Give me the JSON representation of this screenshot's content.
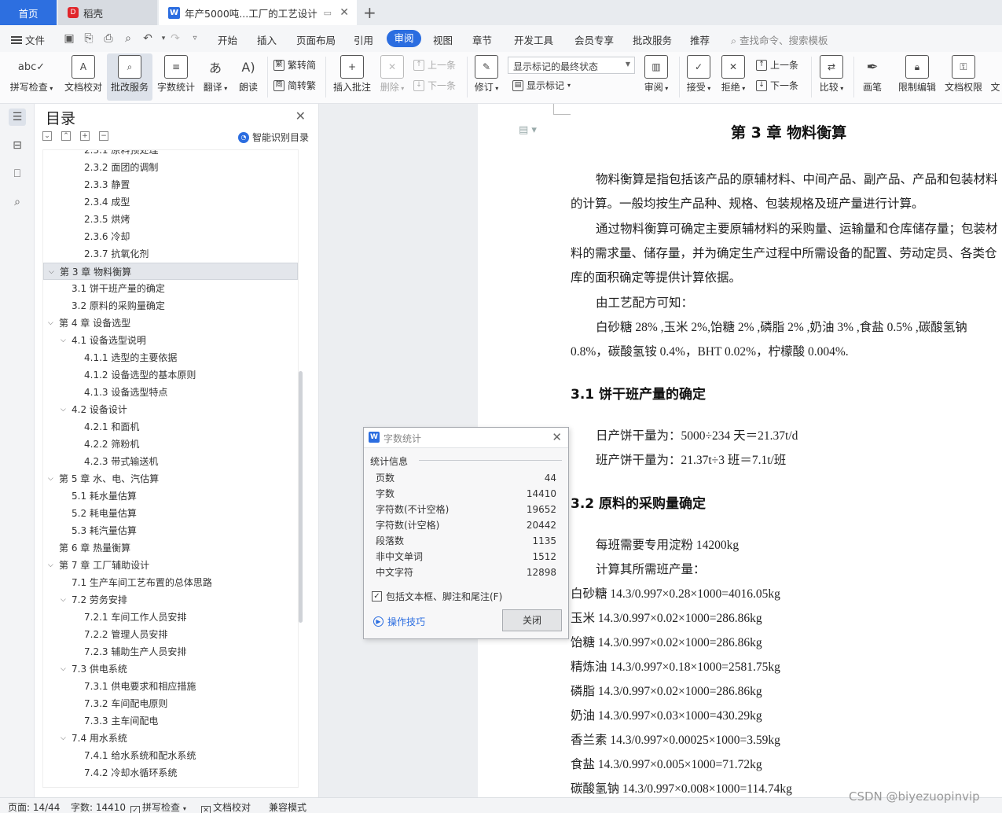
{
  "tabs": {
    "home": "首页",
    "daoke": "稻壳",
    "doc": "年产5000吨...工厂的工艺设计"
  },
  "menu": {
    "file": "文件",
    "items": [
      "开始",
      "插入",
      "页面布局",
      "引用",
      "审阅",
      "视图",
      "章节",
      "开发工具",
      "会员专享",
      "批改服务",
      "推荐"
    ],
    "active": "审阅",
    "search": "查找命令、搜索模板"
  },
  "ribbon": {
    "spell": "拼写检查",
    "doc_check": "文档校对",
    "batch": "批改服务",
    "word_count": "字数统计",
    "translate": "翻译",
    "read": "朗读",
    "trad": "繁转简",
    "simp": "简转繁",
    "insert_comment": "插入批注",
    "delete": "删除",
    "prev": "上一条",
    "next": "下一条",
    "markup_select": "显示标记的最终状态",
    "revise": "修订",
    "show_markup": "显示标记",
    "review": "审阅",
    "accept": "接受",
    "reject": "拒绝",
    "prev2": "上一条",
    "next2": "下一条",
    "compare": "比较",
    "pen": "画笔",
    "restrict": "限制编辑",
    "doc_rights": "文档权限",
    "more": "文"
  },
  "toc": {
    "title": "目录",
    "smart": "智能识别目录",
    "items": [
      {
        "text": "2.3.1  原料预处理",
        "level": 3
      },
      {
        "text": "2.3.2  面团的调制",
        "level": 3
      },
      {
        "text": "2.3.3  静置",
        "level": 3
      },
      {
        "text": "2.3.4  成型",
        "level": 3
      },
      {
        "text": "2.3.5  烘烤",
        "level": 3
      },
      {
        "text": "2.3.6  冷却",
        "level": 3
      },
      {
        "text": "2.3.7  抗氧化剂",
        "level": 3
      },
      {
        "text": "第 3 章  物料衡算",
        "level": 1,
        "expanded": true,
        "selected": true
      },
      {
        "text": "3.1  饼干班产量的确定",
        "level": 2
      },
      {
        "text": "3.2  原料的采购量确定",
        "level": 2
      },
      {
        "text": "第 4 章  设备选型",
        "level": 1,
        "expanded": true
      },
      {
        "text": "4.1  设备选型说明",
        "level": 2,
        "expanded": true
      },
      {
        "text": "4.1.1  选型的主要依据",
        "level": 3
      },
      {
        "text": "4.1.2  设备选型的基本原则",
        "level": 3
      },
      {
        "text": "4.1.3  设备选型特点",
        "level": 3
      },
      {
        "text": "4.2    设备设计",
        "level": 2,
        "expanded": true
      },
      {
        "text": "4.2.1  和面机",
        "level": 3
      },
      {
        "text": "4.2.2  筛粉机",
        "level": 3
      },
      {
        "text": "4.2.3  带式输送机",
        "level": 3
      },
      {
        "text": "第 5 章  水、电、汽估算",
        "level": 1,
        "expanded": true
      },
      {
        "text": "5.1  耗水量估算",
        "level": 2
      },
      {
        "text": "5.2  耗电量估算",
        "level": 2
      },
      {
        "text": "5.3  耗汽量估算",
        "level": 2
      },
      {
        "text": "第 6 章  热量衡算",
        "level": 1
      },
      {
        "text": "第 7 章  工厂辅助设计",
        "level": 1,
        "expanded": true
      },
      {
        "text": "7.1  生产车间工艺布置的总体思路",
        "level": 2
      },
      {
        "text": "7.2  劳务安排",
        "level": 2,
        "expanded": true
      },
      {
        "text": "7.2.1  车间工作人员安排",
        "level": 3
      },
      {
        "text": "7.2.2  管理人员安排",
        "level": 3
      },
      {
        "text": "7.2.3  辅助生产人员安排",
        "level": 3
      },
      {
        "text": "7.3  供电系统",
        "level": 2,
        "expanded": true
      },
      {
        "text": "7.3.1  供电要求和相应措施",
        "level": 3
      },
      {
        "text": "7.3.2  车间配电原则",
        "level": 3
      },
      {
        "text": "7.3.3  主车间配电",
        "level": 3
      },
      {
        "text": "7.4  用水系统",
        "level": 2,
        "expanded": true
      },
      {
        "text": "7.4.1  给水系统和配水系统",
        "level": 3
      },
      {
        "text": "7.4.2  冷却水循环系统",
        "level": 3
      }
    ]
  },
  "document": {
    "chapter_title": "第 3 章  物料衡算",
    "p1a": "物料衡算是指包括该产品的原辅材料、中间产品、副产品、产品和包装材料",
    "p1b": "的计算。一般均按生产品种、规格、包装规格及班产量进行计算。",
    "p2a": "通过物料衡算可确定主要原辅材料的采购量、运输量和仓库储存量；包装材",
    "p2b": "料的需求量、储存量，并为确定生产过程中所需设备的配置、劳动定员、各类仓",
    "p2c": "库的面积确定等提供计算依据。",
    "p3": "由工艺配方可知：",
    "p4a": "白砂糖  28% ,玉米 2%,饴糖 2% ,磷脂 2% ,奶油 3% ,食盐 0.5% ,碳酸氢钠",
    "p4b": "0.8%，碳酸氢铵  0.4%，BHT 0.02%，柠檬酸  0.004%.",
    "h31": "3.1  饼干班产量的确定",
    "daily": "日产饼干量为：5000÷234 天＝21.37t/d",
    "shift": "班产饼干量为：21.37t÷3 班＝7.1t/班",
    "h32": "3.2  原料的采购量确定",
    "starch": "每班需要专用淀粉 14200kg",
    "calc": "计算其所需班产量：",
    "materials": [
      "白砂糖 14.3/0.997×0.28×1000=4016.05kg",
      "玉米 14.3/0.997×0.02×1000=286.86kg",
      "饴糖 14.3/0.997×0.02×1000=286.86kg",
      "精炼油 14.3/0.997×0.18×1000=2581.75kg",
      "磷脂 14.3/0.997×0.02×1000=286.86kg",
      "奶油 14.3/0.997×0.03×1000=430.29kg",
      "香兰素 14.3/0.997×0.00025×1000=3.59kg",
      "食盐 14.3/0.997×0.005×1000=71.72kg",
      "碳酸氢钠 14.3/0.997×0.008×1000=114.74kg"
    ]
  },
  "dialog": {
    "title": "字数统计",
    "group": "统计信息",
    "stats": [
      {
        "label": "页数",
        "value": "44"
      },
      {
        "label": "字数",
        "value": "14410"
      },
      {
        "label": "字符数(不计空格)",
        "value": "19652"
      },
      {
        "label": "字符数(计空格)",
        "value": "20442"
      },
      {
        "label": "段落数",
        "value": "1135"
      },
      {
        "label": "非中文单词",
        "value": "1512"
      },
      {
        "label": "中文字符",
        "value": "12898"
      }
    ],
    "checkbox": "包括文本框、脚注和尾注(F)",
    "tips": "操作技巧",
    "close": "关闭"
  },
  "status": {
    "page": "页面: 14/44",
    "words": "字数: 14410",
    "spell": "拼写检查",
    "doc_check": "文档校对",
    "compat": "兼容模式"
  },
  "watermark": "CSDN @biyezuopinvip",
  "colors": {
    "accent": "#2b6de0",
    "home_tab": "#2d6fe0"
  }
}
